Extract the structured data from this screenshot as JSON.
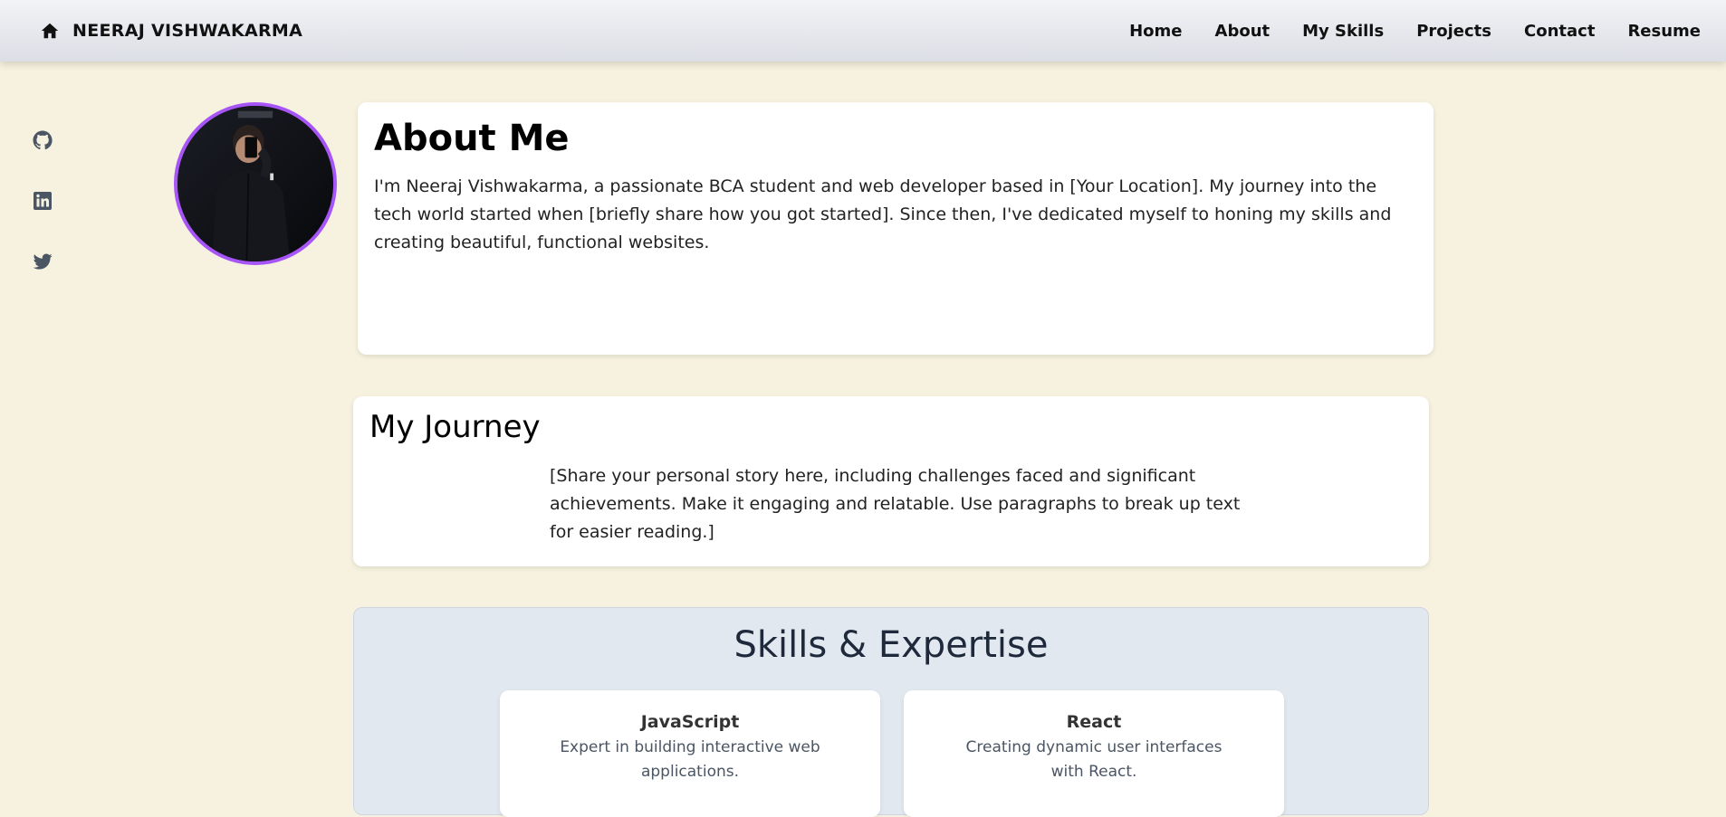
{
  "header": {
    "brand_icon": "home-icon",
    "brand_name": "NEERAJ VISHWAKARMA",
    "nav": [
      {
        "label": "Home"
      },
      {
        "label": "About"
      },
      {
        "label": "My Skills"
      },
      {
        "label": "Projects"
      },
      {
        "label": "Contact"
      },
      {
        "label": "Resume"
      }
    ]
  },
  "social": [
    {
      "icon": "github-icon"
    },
    {
      "icon": "linkedin-icon"
    },
    {
      "icon": "twitter-icon"
    }
  ],
  "about": {
    "title": "About Me",
    "text": "I'm Neeraj Vishwakarma, a passionate BCA student and web developer based in [Your Location]. My journey into the tech world started when [briefly share how you got started]. Since then, I've dedicated myself to honing my skills and creating beautiful, functional websites."
  },
  "journey": {
    "title": "My Journey",
    "text": "[Share your personal story here, including challenges faced and significant achievements. Make it engaging and relatable. Use paragraphs to break up text for easier reading.]"
  },
  "skills": {
    "title": "Skills & Expertise",
    "items": [
      {
        "name": "JavaScript",
        "desc": "Expert in building interactive web applications."
      },
      {
        "name": "React",
        "desc": "Creating dynamic user interfaces with React."
      }
    ]
  },
  "colors": {
    "page_bg": "#f6f2df",
    "avatar_ring": "#a855f7",
    "skills_bg": "#e2e8f0",
    "icon_gray": "#4b5563"
  }
}
